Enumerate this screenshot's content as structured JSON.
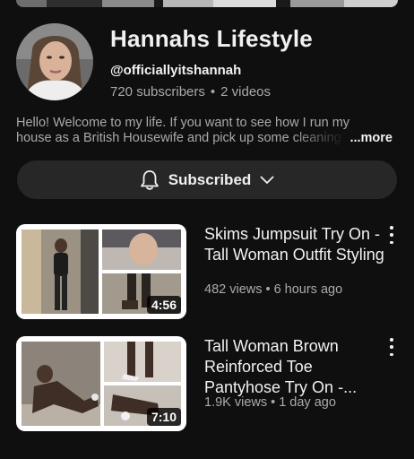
{
  "channel": {
    "name": "Hannahs Lifestyle",
    "handle": "@officiallyitshannah",
    "subscribers": "720 subscribers",
    "separator": "•",
    "videos_count": "2 videos",
    "description_line1": "Hello! Welcome to my life. If you want to see how I run my",
    "description_line2": "house as a British Housewife and pick up some cleaning",
    "more_label": "...more",
    "subscribe_label": "Subscribed"
  },
  "icons": {
    "subscribe_left": "bell-icon",
    "subscribe_right": "chevron-down-icon",
    "video_menu": "more-vertical-icon"
  },
  "videos": [
    {
      "title": "Skims Jumpsuit Try On - Tall Woman Outfit Styling",
      "views": "482 views",
      "separator": "•",
      "age": "6 hours ago",
      "duration": "4:56"
    },
    {
      "title": "Tall Woman Brown Reinforced Toe Pantyhose Try On -...",
      "views": "1.9K views",
      "separator": "•",
      "age": "1 day ago",
      "duration": "7:10"
    }
  ],
  "colors": {
    "background": "#0f0f0f",
    "primary_text": "#f1f1f1",
    "secondary_text": "#aaaaaa",
    "button_bg": "#272727"
  }
}
